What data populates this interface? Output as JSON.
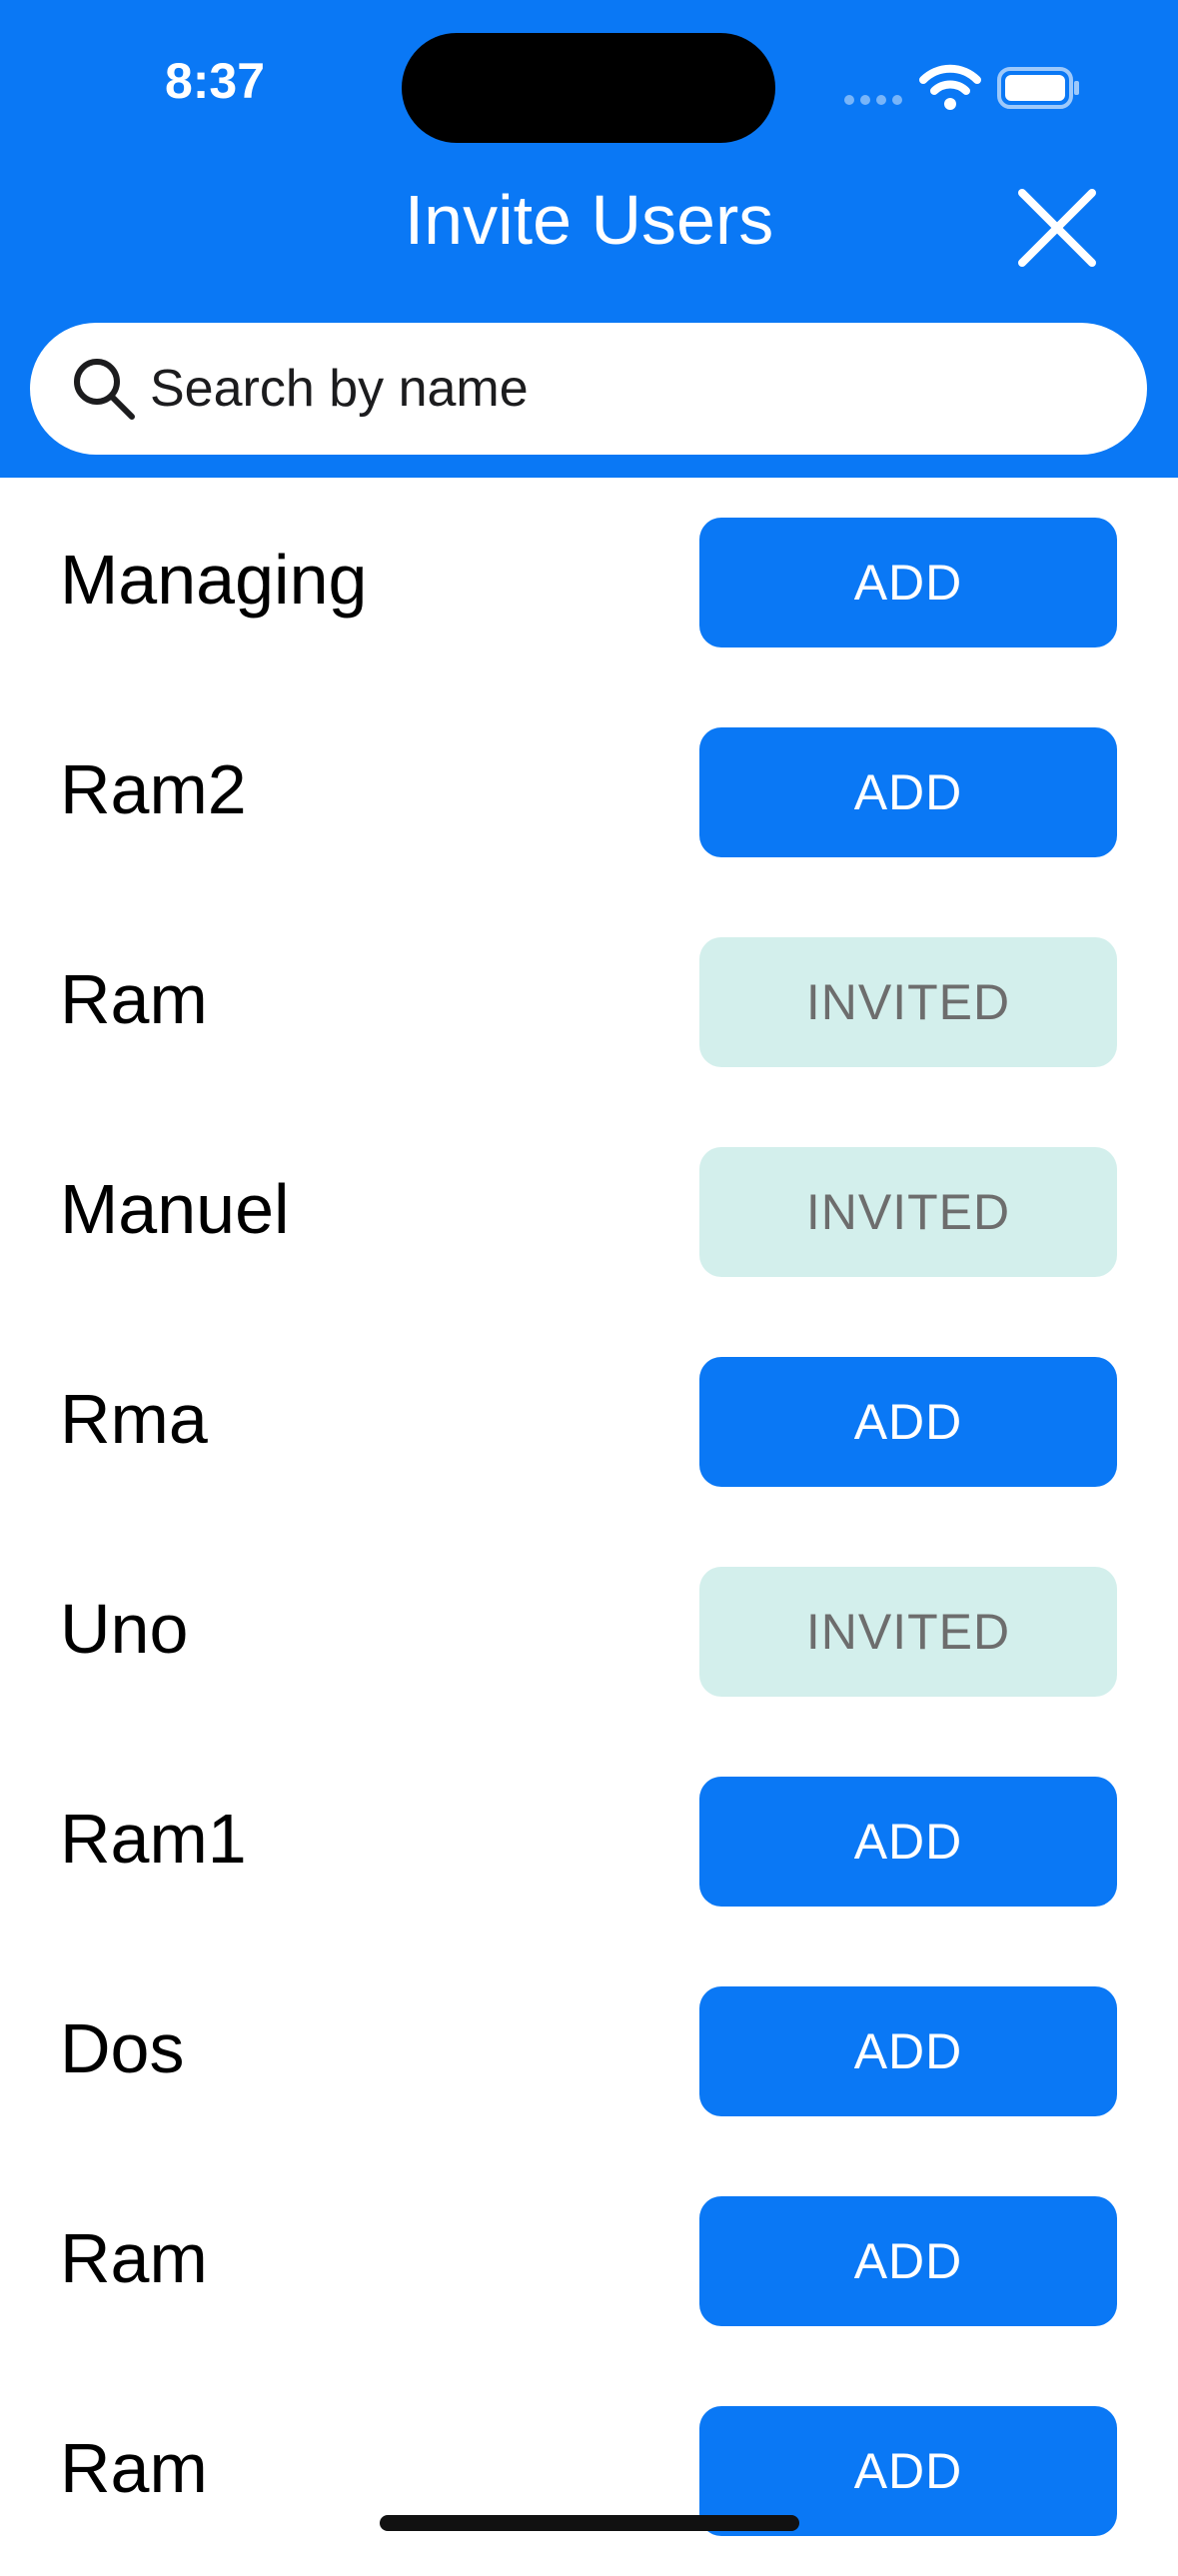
{
  "status_bar": {
    "time": "8:37"
  },
  "header": {
    "title": "Invite Users",
    "close_icon": "close-icon",
    "background_color": "#0a78f5"
  },
  "search": {
    "placeholder": "Search by name",
    "value": "",
    "icon": "search-icon"
  },
  "users": [
    {
      "name": "Managing",
      "action": "ADD",
      "state": "add"
    },
    {
      "name": "Ram2",
      "action": "ADD",
      "state": "add"
    },
    {
      "name": "Ram",
      "action": "INVITED",
      "state": "invited"
    },
    {
      "name": "Manuel",
      "action": "INVITED",
      "state": "invited"
    },
    {
      "name": "Rma",
      "action": "ADD",
      "state": "add"
    },
    {
      "name": "Uno",
      "action": "INVITED",
      "state": "invited"
    },
    {
      "name": "Ram1",
      "action": "ADD",
      "state": "add"
    },
    {
      "name": "Dos",
      "action": "ADD",
      "state": "add"
    },
    {
      "name": "Ram",
      "action": "ADD",
      "state": "add"
    },
    {
      "name": "Ram",
      "action": "ADD",
      "state": "add"
    }
  ],
  "colors": {
    "accent": "#0a78f5",
    "invited_bg": "#d3efec",
    "invited_text": "#6d6d6d"
  }
}
